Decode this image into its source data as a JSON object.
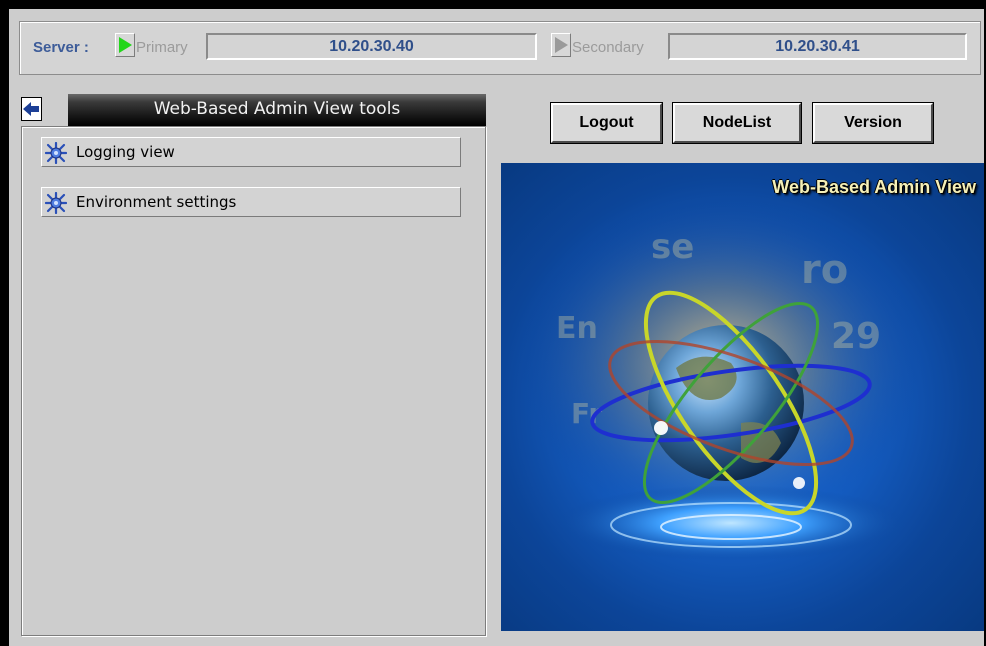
{
  "server_bar": {
    "label": "Server :",
    "primary": {
      "name": "Primary",
      "ip": "10.20.30.40",
      "indicator_color": "#22d61a"
    },
    "secondary": {
      "name": "Secondary",
      "ip": "10.20.30.41",
      "indicator_color": "#9a9a9a"
    }
  },
  "tools_panel": {
    "title": "Web-Based Admin View  tools",
    "items": [
      {
        "label": "Logging view",
        "icon": "gear-bug-icon"
      },
      {
        "label": "Environment settings",
        "icon": "gear-bug-icon"
      }
    ]
  },
  "actions": {
    "logout_label": "Logout",
    "nodelist_label": "NodeList",
    "version_label": "Version"
  },
  "banner": {
    "title": "Web-Based Admin View",
    "image": "globe-with-orbits-illustration"
  },
  "colors": {
    "server_label": "#3d5c99",
    "ip_text": "#2f4f8a",
    "banner_background": "#0a3f8c",
    "banner_title": "#f5f0b8"
  }
}
